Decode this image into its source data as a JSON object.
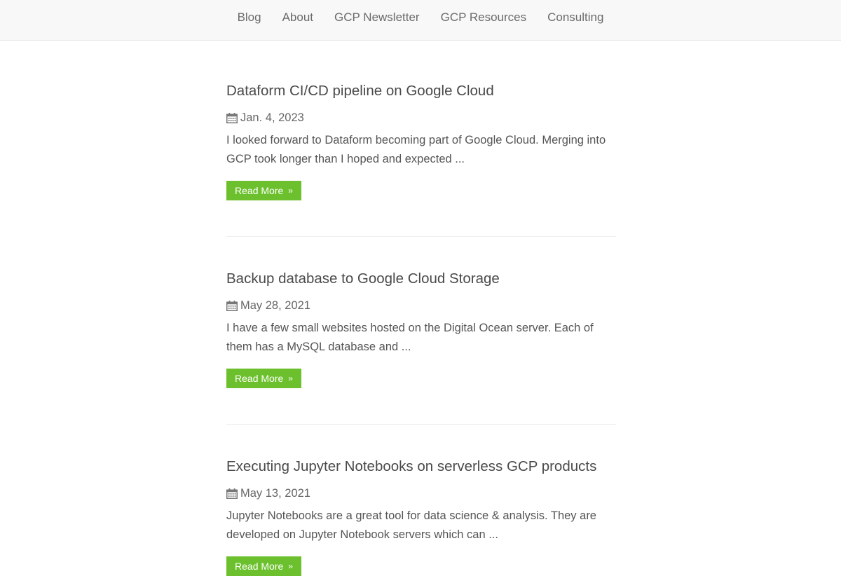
{
  "nav": {
    "items": [
      {
        "label": "Blog"
      },
      {
        "label": "About"
      },
      {
        "label": "GCP Newsletter"
      },
      {
        "label": "GCP Resources"
      },
      {
        "label": "Consulting"
      }
    ]
  },
  "posts": [
    {
      "title": "Dataform CI/CD pipeline on Google Cloud",
      "date": "Jan. 4, 2023",
      "excerpt": "I looked forward to Dataform becoming part of Google Cloud. Merging into GCP took longer than I hoped and expected ...",
      "read_more": "Read More"
    },
    {
      "title": "Backup database to Google Cloud Storage",
      "date": "May 28, 2021",
      "excerpt": "I have a few small websites hosted on the Digital Ocean server. Each of them has a MySQL database and ...",
      "read_more": "Read More"
    },
    {
      "title": "Executing Jupyter Notebooks on serverless GCP products",
      "date": "May 13, 2021",
      "excerpt": "Jupyter Notebooks are a great tool for data science & analysis. They are developed on Jupyter Notebook servers which can ...",
      "read_more": "Read More"
    }
  ],
  "icons": {
    "date_icon": "calendar-icon",
    "read_more_icon": "double-chevron-right-icon"
  },
  "colors": {
    "accent": "#6cc02d",
    "navbar_bg": "#f8f8f8"
  }
}
